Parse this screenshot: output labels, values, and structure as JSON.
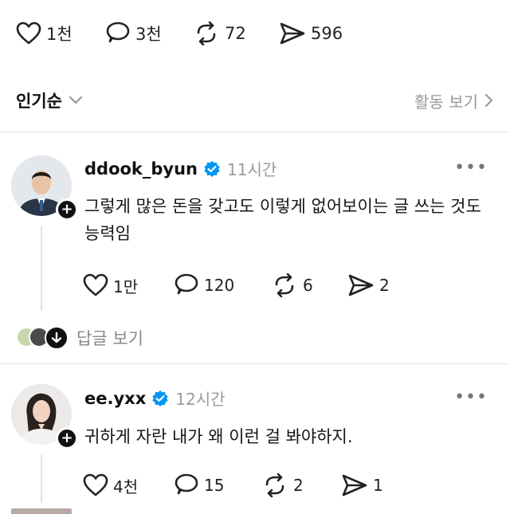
{
  "post_stats": {
    "likes": "1천",
    "comments": "3천",
    "reposts": "72",
    "shares": "596"
  },
  "sort_bar": {
    "sort_label": "인기순",
    "activity_label": "활동 보기"
  },
  "comments": [
    {
      "username": "ddook_byun",
      "verified": true,
      "time": "11시간",
      "text": "그렇게 많은 돈을 갖고도 이렇게 없어보이는 글 쓰는 것도 능력임",
      "likes": "1만",
      "replies": "120",
      "reposts": "6",
      "shares": "2",
      "view_replies_label": "답글 보기"
    },
    {
      "username": "ee.yxx",
      "verified": true,
      "time": "12시간",
      "text": "귀하게 자란 내가 왜 이런 걸 봐야하지.",
      "likes": "4천",
      "replies": "15",
      "reposts": "2",
      "shares": "1"
    }
  ],
  "icons": {
    "like": "heart-icon",
    "comment": "speech-bubble-icon",
    "repost": "repost-icon",
    "share": "send-icon",
    "verified": "verified-badge-icon",
    "more": "more-icon",
    "chevron_down": "chevron-down-icon",
    "chevron_right": "chevron-right-icon"
  },
  "colors": {
    "verified_blue": "#0095f6",
    "text_primary": "#111111",
    "text_secondary": "#999999"
  }
}
